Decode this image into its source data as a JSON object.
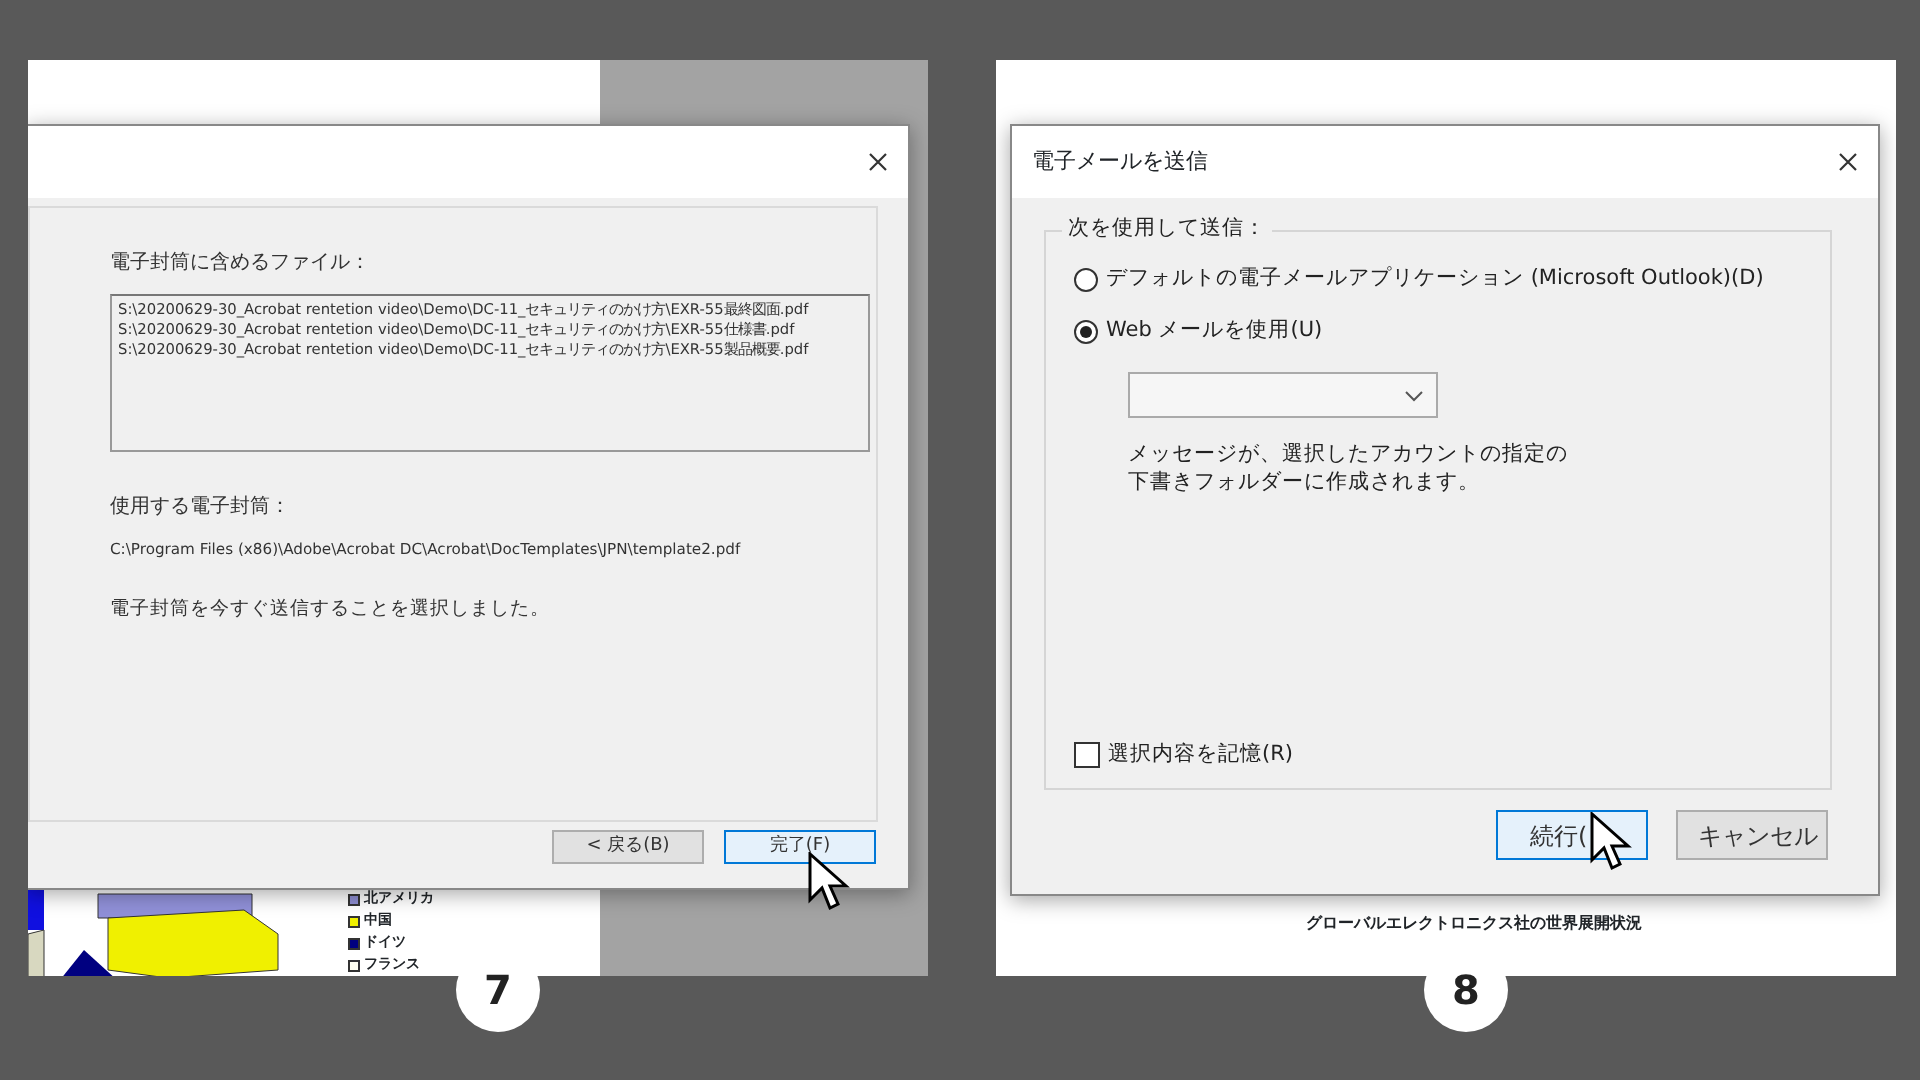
{
  "left_panel": {
    "badge": "7",
    "document": {
      "legend": [
        {
          "label": "北アメリカ",
          "color": "#8c8cd0"
        },
        {
          "label": "中国",
          "color": "#f0f000"
        },
        {
          "label": "ドイツ",
          "color": "#000080"
        },
        {
          "label": "フランス",
          "color": "#fffff0"
        }
      ]
    },
    "dialog": {
      "files_label": "電子封筒に含めるファイル：",
      "files": [
        "S:\\20200629-30_Acrobat rentetion video\\Demo\\DC-11_セキュリティのかけ方\\EXR-55最終図面.pdf",
        "S:\\20200629-30_Acrobat rentetion video\\Demo\\DC-11_セキュリティのかけ方\\EXR-55仕様書.pdf",
        "S:\\20200629-30_Acrobat rentetion video\\Demo\\DC-11_セキュリティのかけ方\\EXR-55製品概要.pdf"
      ],
      "template_label": "使用する電子封筒：",
      "template_path": "C:\\Program Files (x86)\\Adobe\\Acrobat DC\\Acrobat\\DocTemplates\\JPN\\template2.pdf",
      "message": "電子封筒を今すぐ送信することを選択しました。",
      "buttons": [
        {
          "label": "< 戻る(B)",
          "focused": false
        },
        {
          "label": "完了(F)",
          "focused": true
        }
      ]
    }
  },
  "right_panel": {
    "badge": "8",
    "caption": "グローバルエレクトロニクス社の世界展開状況",
    "dialog": {
      "title": "電子メールを送信",
      "group_label": "次を使用して送信：",
      "options": [
        {
          "label": "デフォルトの電子メールアプリケーション (Microsoft Outlook)(D)",
          "selected": false
        },
        {
          "label": "Web メールを使用(U)",
          "selected": true
        }
      ],
      "note_lines": [
        "メッセージが、選択したアカウントの指定の",
        "下書きフォルダーに作成されます。"
      ],
      "remember": {
        "label": "選択内容を記憶(R)",
        "checked": false
      },
      "buttons": [
        {
          "label": "続行(",
          "focused": true
        },
        {
          "label": "キャンセル",
          "focused": false
        }
      ]
    }
  }
}
